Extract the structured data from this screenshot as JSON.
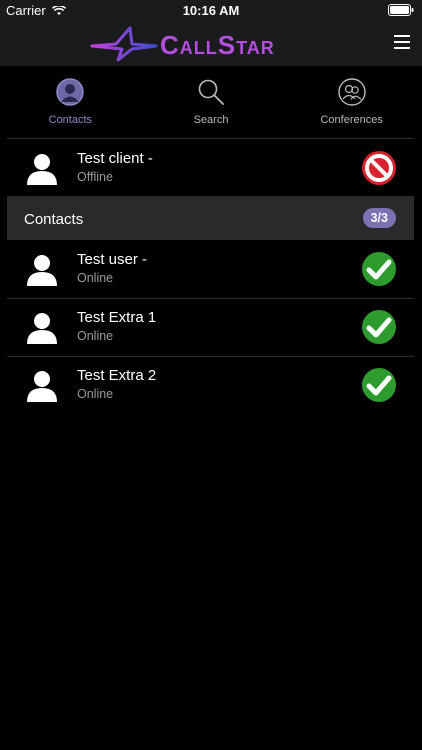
{
  "status_bar": {
    "carrier": "Carrier",
    "time": "10:16 AM"
  },
  "header": {
    "app_name": "CallStar",
    "menu_icon": "hamburger-menu-icon"
  },
  "tabs": [
    {
      "label": "Contacts",
      "icon": "user-circle-icon",
      "active": true
    },
    {
      "label": "Search",
      "icon": "search-icon",
      "active": false
    },
    {
      "label": "Conferences",
      "icon": "group-circle-icon",
      "active": false
    }
  ],
  "self": {
    "name": "Test client -",
    "status": "Offline",
    "status_icon": "do-not-disturb-icon"
  },
  "section": {
    "title": "Contacts",
    "count": "3/3"
  },
  "contacts": [
    {
      "name": "Test user -",
      "status": "Online",
      "status_icon": "check-circle-icon"
    },
    {
      "name": "Test Extra 1",
      "status": "Online",
      "status_icon": "check-circle-icon"
    },
    {
      "name": "Test Extra 2",
      "status": "Online",
      "status_icon": "check-circle-icon"
    }
  ],
  "colors": {
    "accent": "#7a72b3",
    "active_tab": "#8e88c4",
    "online": "#2e9b2e",
    "offline": "#d8222f",
    "header_bg": "#1b1b1d",
    "section_bg": "#2a2a2c"
  }
}
